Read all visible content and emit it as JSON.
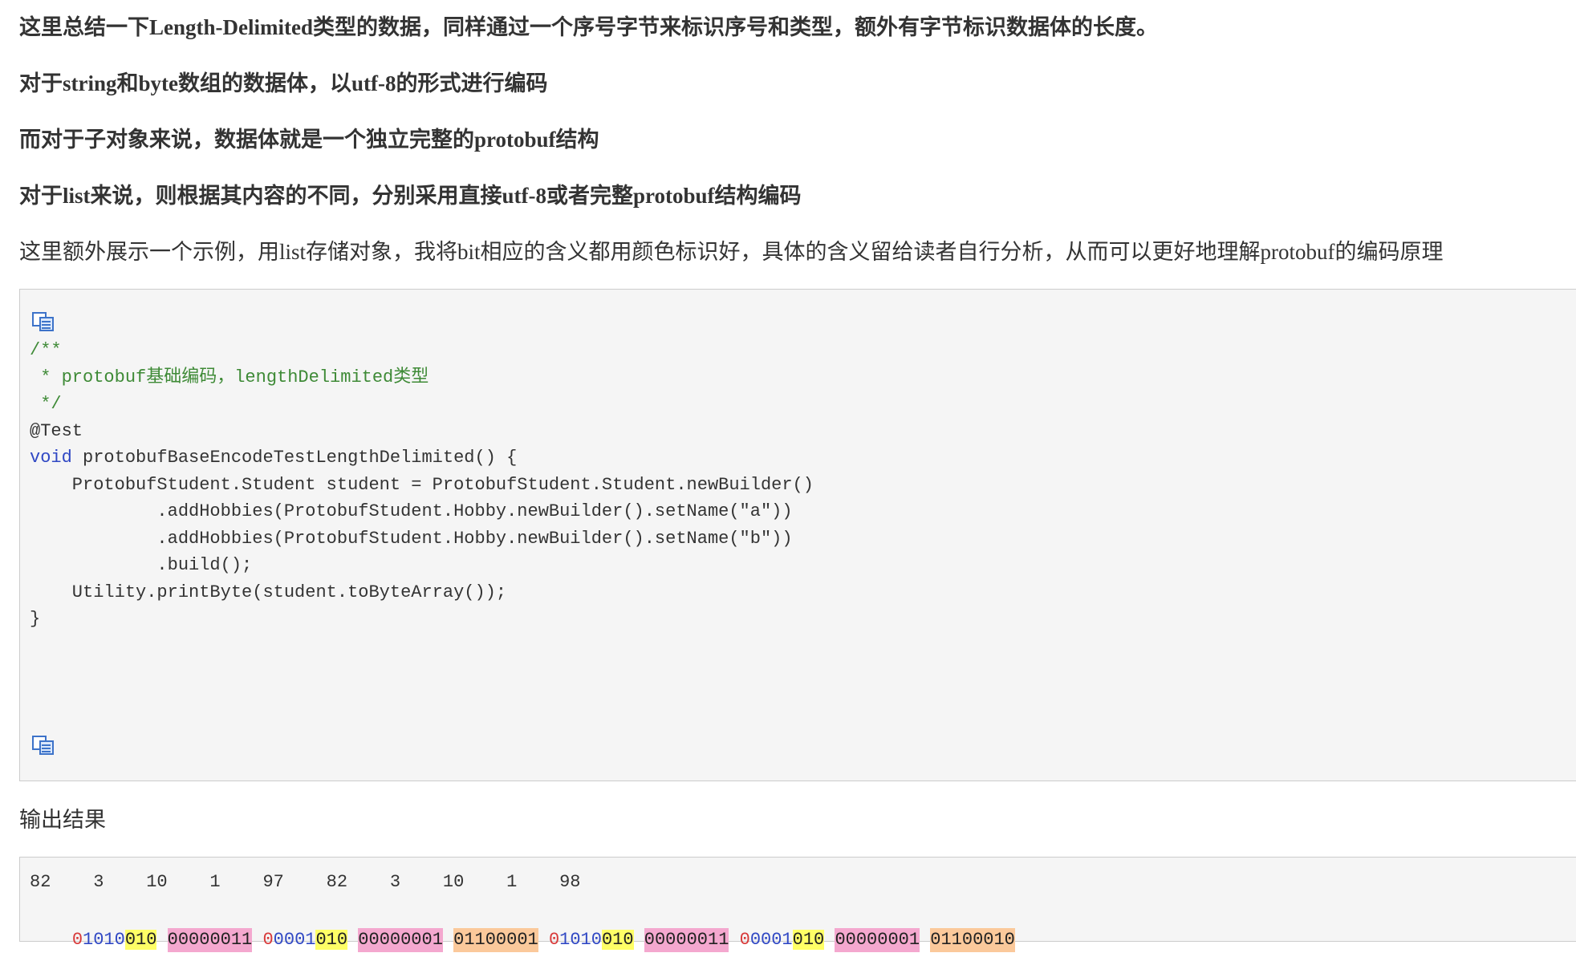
{
  "paragraphs": {
    "p1": "这里总结一下Length-Delimited类型的数据，同样通过一个序号字节来标识序号和类型，额外有字节标识数据体的长度。",
    "p2": "对于string和byte数组的数据体，以utf-8的形式进行编码",
    "p3": "而对于子对象来说，数据体就是一个独立完整的protobuf结构",
    "p4": "对于list来说，则根据其内容的不同，分别采用直接utf-8或者完整protobuf结构编码",
    "p5": "这里额外展示一个示例，用list存储对象，我将bit相应的含义都用颜色标识好，具体的含义留给读者自行分析，从而可以更好地理解protobuf的编码原理"
  },
  "code": {
    "copy_icon": "copy-code-icon",
    "lines": [
      "/**",
      " * protobuf基础编码，lengthDelimited类型",
      " */",
      "@Test",
      "void",
      " protobufBaseEncodeTestLengthDelimited() {",
      "    ProtobufStudent.Student student = ProtobufStudent.Student.newBuilder()",
      "            .addHobbies(ProtobufStudent.Hobby.newBuilder().setName(\"a\"))",
      "            .addHobbies(ProtobufStudent.Hobby.newBuilder().setName(\"b\"))",
      "            .build();",
      "    Utility.printByte(student.toByteArray());",
      "}"
    ]
  },
  "output_label": "输出结果",
  "output": {
    "values": "82    3    10    1    97    82    3    10    1    98",
    "bytes": [
      {
        "a": "0",
        "b": "1010",
        "c": "010"
      },
      {
        "p": "00000011"
      },
      {
        "a": "0",
        "b": "0001",
        "c": "010"
      },
      {
        "p": "00000001"
      },
      {
        "o": "01100001"
      },
      {
        "a": "0",
        "b": "1010",
        "c": "010"
      },
      {
        "p": "00000011"
      },
      {
        "a": "0",
        "b": "0001",
        "c": "010"
      },
      {
        "p": "00000001"
      },
      {
        "o": "01100010"
      }
    ]
  },
  "colors": {
    "comment": "#3e8a36",
    "keyword": "#3048c4",
    "bit_msb": "#d83a3a",
    "bit_field": "#3048c4",
    "bit_type": "#ffff66",
    "length_byte": "#f4a8cf",
    "data_byte": "#fbc99b"
  }
}
